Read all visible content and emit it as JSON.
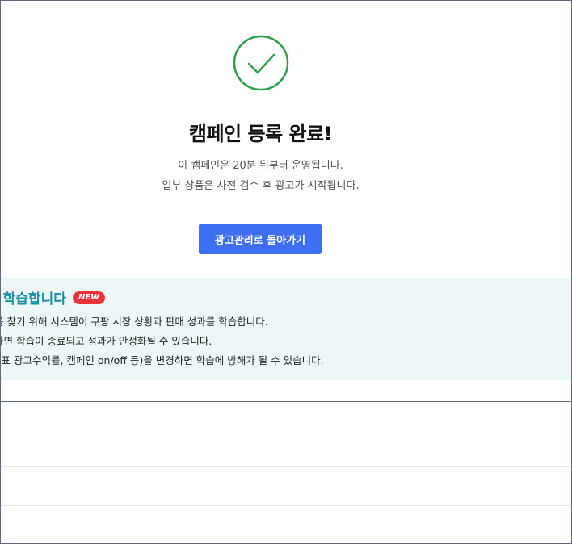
{
  "modal": {
    "title": "캠페인 등록 완료!",
    "subtitle_line1": "이 캠페인은 20분 뒤부터 운영됩니다.",
    "subtitle_line2": "일부 상품은 사전 검수 후 광고가 시작됩니다.",
    "back_button_label": "광고관리로 돌아가기",
    "icon": "check-circle-icon"
  },
  "info": {
    "title": "l 학습합니다",
    "badge": "NEW",
    "lines": [
      "를 찾기 위해 시스템이 쿠팡 시장 상황과 판매 성과를 학습합니다.",
      "하면 학습이 종료되고 성과가 안정화될 수 있습니다.",
      "목표 광고수익률, 캠페인 on/off 등)을 변경하면 학습에 방해가 될 수 있습니다."
    ]
  },
  "colors": {
    "accent": "#3e6ef2",
    "success": "#2e9e4f",
    "info_title": "#1a8ea6",
    "badge": "#e8323c",
    "info_bg": "#eef7f7"
  }
}
